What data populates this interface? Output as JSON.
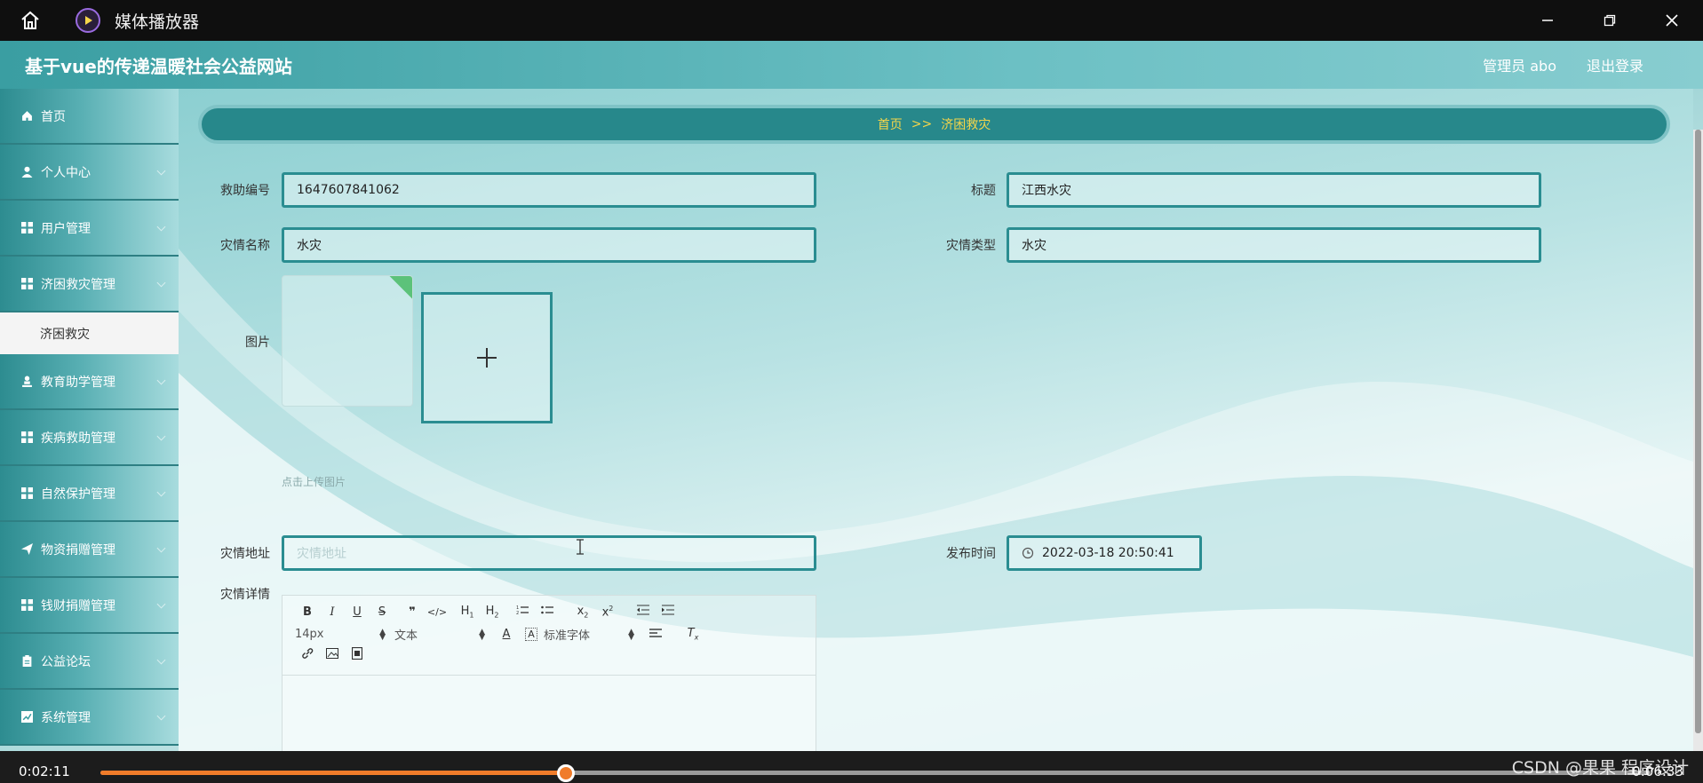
{
  "player": {
    "window_title": "媒体播放器",
    "current_time": "0:02:11",
    "total_time": "0:06:33",
    "progress": 0.3,
    "watermark": "CSDN @果果 程序设计",
    "accent": "#f07c2a"
  },
  "header": {
    "site_title": "基于vue的传递温暖社会公益网站",
    "user_label": "管理员 abo",
    "logout_label": "退出登录"
  },
  "sidebar": {
    "items": [
      {
        "label": "首页",
        "icon": "home-icon"
      },
      {
        "label": "个人中心",
        "icon": "user-icon"
      },
      {
        "label": "用户管理",
        "icon": "grid-icon"
      },
      {
        "label": "济困救灾管理",
        "icon": "grid-icon"
      },
      {
        "label": "教育助学管理",
        "icon": "person-icon"
      },
      {
        "label": "疾病救助管理",
        "icon": "grid-icon"
      },
      {
        "label": "自然保护管理",
        "icon": "grid-icon"
      },
      {
        "label": "物资捐赠管理",
        "icon": "send-icon"
      },
      {
        "label": "钱财捐赠管理",
        "icon": "grid-icon"
      },
      {
        "label": "公益论坛",
        "icon": "clipboard-icon"
      },
      {
        "label": "系统管理",
        "icon": "chart-icon"
      }
    ],
    "sub_item": "济困救灾"
  },
  "breadcrumb": {
    "home": "首页",
    "separator": ">>",
    "current": "济困救灾"
  },
  "form": {
    "aid_number": {
      "label": "救助编号",
      "value": "1647607841062"
    },
    "title": {
      "label": "标题",
      "value": "江西水灾"
    },
    "disaster_name": {
      "label": "灾情名称",
      "value": "水灾"
    },
    "disaster_type": {
      "label": "灾情类型",
      "value": "水灾"
    },
    "image": {
      "label": "图片",
      "hint": "点击上传图片"
    },
    "address": {
      "label": "灾情地址",
      "placeholder": "灾情地址"
    },
    "publish_time": {
      "label": "发布时间",
      "value": "2022-03-18 20:50:41"
    },
    "details": {
      "label": "灾情详情"
    }
  },
  "editor": {
    "font_size": "14px",
    "paragraph": "文本",
    "font_family": "标准字体"
  },
  "colors": {
    "primary": "#27888b",
    "breadcrumb_text": "#f5d64a"
  }
}
